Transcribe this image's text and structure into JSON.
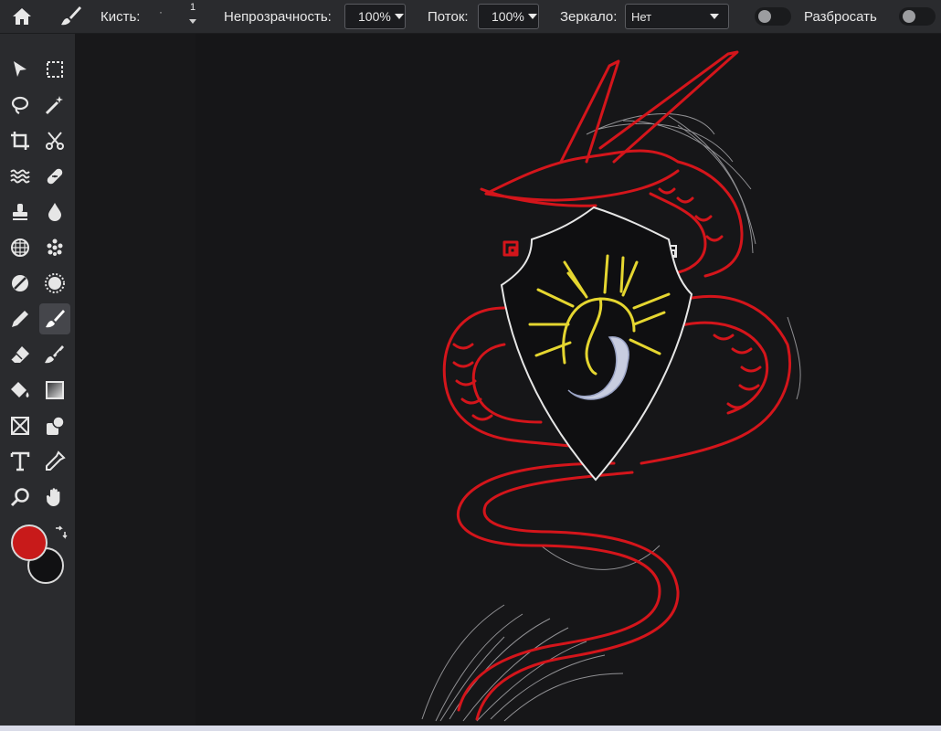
{
  "toolbar": {
    "home_icon": "home-icon",
    "brush_icon": "brush-icon",
    "brush_label": "Кисть:",
    "brush_size": "1",
    "opacity_label": "Непрозрачность:",
    "opacity_value": "100%",
    "flow_label": "Поток:",
    "flow_value": "100%",
    "mirror_label": "Зеркало:",
    "mirror_value": "Нет",
    "scatter_label": "Разбросать"
  },
  "tools": [
    "move-tool",
    "marquee-tool",
    "lasso-tool",
    "magic-wand-tool",
    "crop-tool",
    "cut-tool",
    "liquify-tool",
    "healing-tool",
    "stamp-tool",
    "blur-tool",
    "pattern-tool",
    "sponge-tool",
    "dodge-tool",
    "burn-tool",
    "pencil-tool",
    "brush-tool",
    "eraser-tool",
    "clone-brush-tool",
    "fill-tool",
    "gradient-tool",
    "frame-tool",
    "shape-tool",
    "text-tool",
    "eyedropper-tool",
    "zoom-tool",
    "hand-tool"
  ],
  "colors": {
    "foreground": "#c81a1a",
    "background": "#111113",
    "toolbar_bg": "#2a2b2e",
    "canvas_bg": "#121214",
    "dragon": "#d4151b",
    "sun": "#e5d630",
    "shield_outline": "#e6e6e6"
  }
}
